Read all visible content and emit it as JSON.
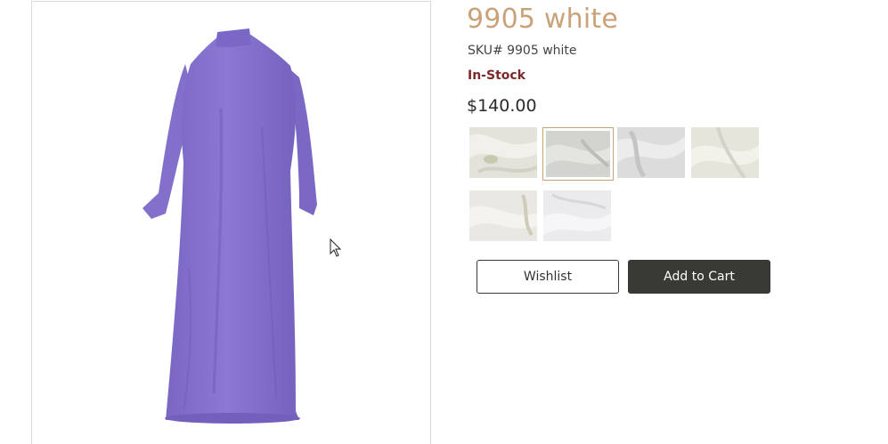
{
  "product": {
    "title": "9905 white",
    "sku": "SKU# 9905 white",
    "stock_status": "In-Stock",
    "price": "$140.00",
    "title_color": "#c9a27a",
    "stock_color": "#7a2a2a",
    "garment_color": "#8673cd"
  },
  "swatches": [
    {
      "name": "fabric-1",
      "selected": false
    },
    {
      "name": "fabric-2",
      "selected": true
    },
    {
      "name": "fabric-3",
      "selected": false
    },
    {
      "name": "fabric-4",
      "selected": false
    },
    {
      "name": "fabric-5",
      "selected": false
    },
    {
      "name": "fabric-6",
      "selected": false
    }
  ],
  "actions": {
    "wishlist_label": "Wishlist",
    "add_to_cart_label": "Add to Cart"
  },
  "icons": {
    "cursor": "mouse-pointer-icon"
  }
}
